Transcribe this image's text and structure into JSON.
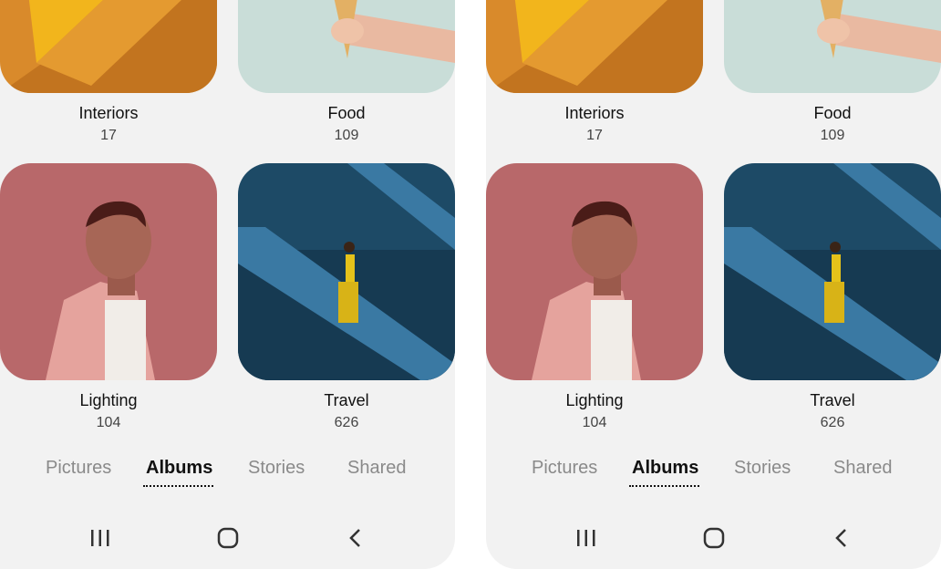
{
  "albums": [
    {
      "title": "Interiors",
      "count": "17"
    },
    {
      "title": "Food",
      "count": "109"
    },
    {
      "title": "Lighting",
      "count": "104"
    },
    {
      "title": "Travel",
      "count": "626"
    }
  ],
  "tabs": [
    {
      "label": "Pictures",
      "active": false
    },
    {
      "label": "Albums",
      "active": true
    },
    {
      "label": "Stories",
      "active": false
    },
    {
      "label": "Shared",
      "active": false
    }
  ],
  "navigation": {
    "recent_icon": "recent-apps-icon",
    "home_icon": "home-icon",
    "back_icon": "back-icon"
  },
  "colors": {
    "background": "#f2f2f2",
    "interiors": "#d98a2b",
    "food": "#c9ddd8",
    "lighting": "#b8686a",
    "travel": "#1d4a66"
  }
}
